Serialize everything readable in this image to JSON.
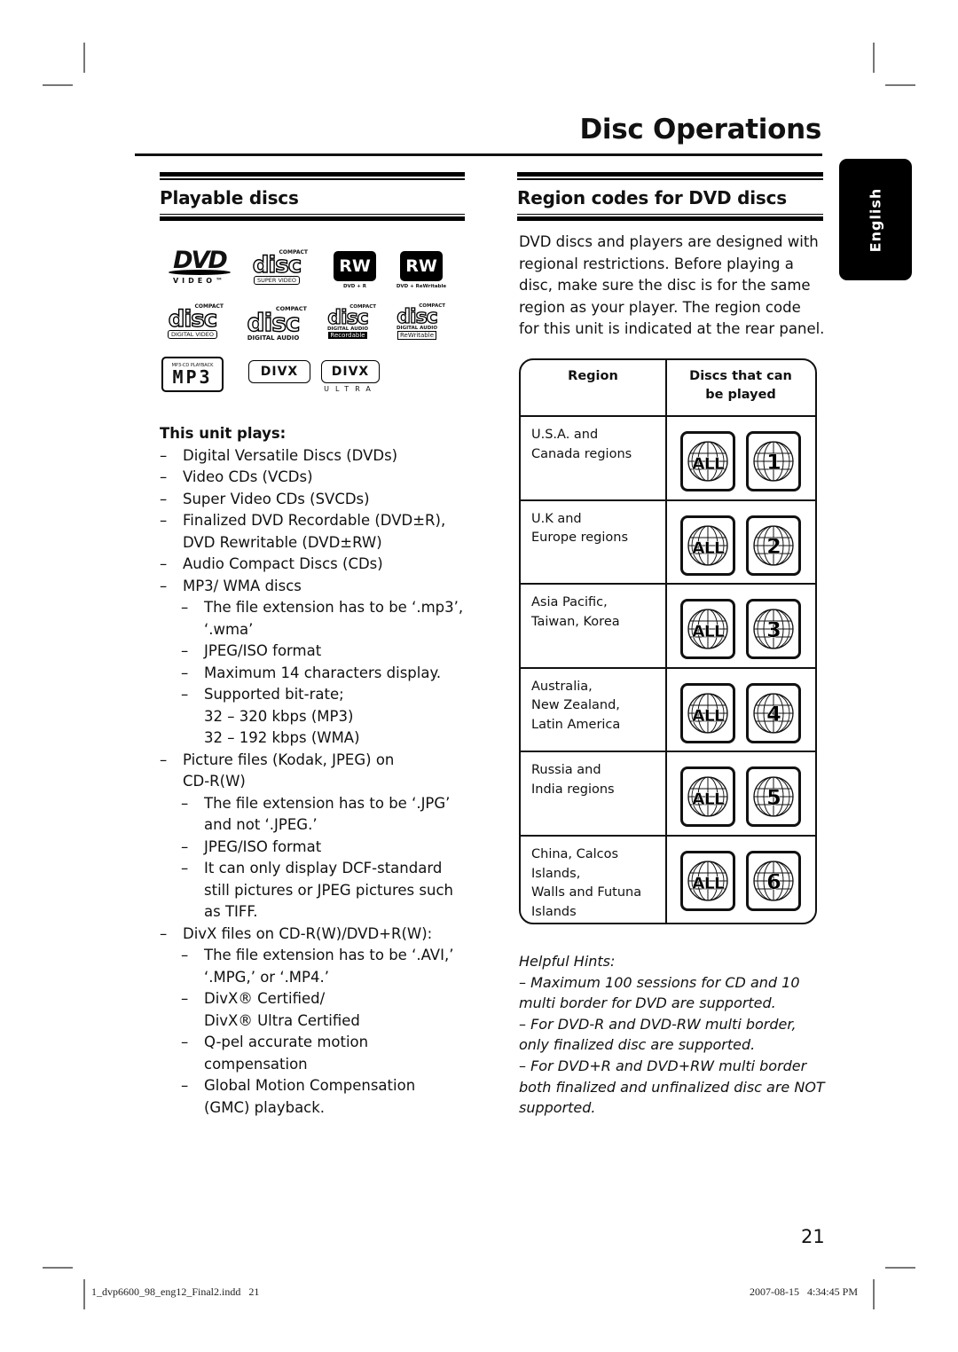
{
  "page": {
    "title": "Disc Operations",
    "page_number": "21",
    "language_tab": "English"
  },
  "playable": {
    "heading": "Playable discs",
    "logos": [
      {
        "name": "dvd-video-logo",
        "main": "DVD",
        "sub": "VIDEO™"
      },
      {
        "name": "compact-disc-super-video-logo",
        "top": "COMPACT",
        "main": "disc",
        "sub": "SUPER VIDEO"
      },
      {
        "name": "dvd-plus-r-logo",
        "main": "RW",
        "sub": "DVD + R"
      },
      {
        "name": "dvd-plus-rewritable-logo",
        "main": "RW",
        "sub": "DVD + ReWritable"
      },
      {
        "name": "compact-disc-digital-video-logo",
        "top": "COMPACT",
        "main": "disc",
        "sub": "DIGITAL VIDEO"
      },
      {
        "name": "compact-disc-digital-audio-logo",
        "top": "COMPACT",
        "main": "disc",
        "sub": "DIGITAL AUDIO"
      },
      {
        "name": "compact-disc-recordable-logo",
        "top": "COMPACT",
        "main": "disc",
        "sub": "DIGITAL AUDIO",
        "sub2": "Recordable"
      },
      {
        "name": "compact-disc-rewritable-logo",
        "top": "COMPACT",
        "main": "disc",
        "sub": "DIGITAL AUDIO",
        "sub2": "ReWritable"
      },
      {
        "name": "mp3-cd-playback-logo",
        "top": "MP3-CD PLAYBACK",
        "main": "MP3"
      },
      {
        "name": "divx-logo",
        "main": "DIVX"
      },
      {
        "name": "divx-ultra-logo",
        "main": "DIVX",
        "sub": "ULTRA"
      }
    ],
    "list_heading": "This unit plays:",
    "items": [
      {
        "level": 1,
        "lines": [
          "Digital Versatile Discs (DVDs)"
        ]
      },
      {
        "level": 1,
        "lines": [
          "Video CDs (VCDs)"
        ]
      },
      {
        "level": 1,
        "lines": [
          "Super Video CDs (SVCDs)"
        ]
      },
      {
        "level": 1,
        "lines": [
          "Finalized DVD Recordable (DVD±R),",
          "DVD Rewritable (DVD±RW)"
        ]
      },
      {
        "level": 1,
        "lines": [
          "Audio Compact Discs (CDs)"
        ]
      },
      {
        "level": 1,
        "lines": [
          "MP3/ WMA discs"
        ]
      },
      {
        "level": 2,
        "lines": [
          "The file extension has to be ‘.mp3’,",
          "‘.wma’"
        ]
      },
      {
        "level": 2,
        "lines": [
          "JPEG/ISO format"
        ]
      },
      {
        "level": 2,
        "lines": [
          "Maximum 14 characters display."
        ]
      },
      {
        "level": 2,
        "lines": [
          "Supported bit-rate;",
          "32 – 320 kbps (MP3)",
          "32 – 192 kbps (WMA)"
        ]
      },
      {
        "level": 1,
        "lines": [
          "Picture files (Kodak, JPEG) on",
          "CD-R(W)"
        ]
      },
      {
        "level": 2,
        "lines": [
          "The file extension has to be ‘.JPG’",
          "and not ‘.JPEG.’"
        ]
      },
      {
        "level": 2,
        "lines": [
          "JPEG/ISO format"
        ]
      },
      {
        "level": 2,
        "lines": [
          "It can only display DCF-standard",
          "still pictures or JPEG pictures such",
          "as TIFF."
        ]
      },
      {
        "level": 1,
        "lines": [
          "DivX files on CD-R(W)/DVD+R(W):"
        ]
      },
      {
        "level": 2,
        "lines": [
          "The file extension has to be ‘.AVI,’",
          "‘.MPG,’ or ‘.MP4.’"
        ]
      },
      {
        "level": 2,
        "lines": [
          "DivX® Certified/",
          "DivX® Ultra Certified"
        ]
      },
      {
        "level": 2,
        "lines": [
          "Q-pel accurate motion",
          "compensation"
        ]
      },
      {
        "level": 2,
        "lines": [
          "Global Motion Compensation",
          "(GMC) playback."
        ]
      }
    ],
    "dash": "–"
  },
  "region": {
    "heading": "Region codes for DVD discs",
    "intro": "DVD discs and players are designed with regional restrictions. Before playing a disc, make sure the disc is for the same region as your player. The region code for this unit is indicated at the rear panel.",
    "table": {
      "col_region": "Region",
      "col_discs": "Discs that can be played",
      "rows": [
        {
          "region": [
            "U.S.A. and",
            "Canada regions"
          ],
          "codes": [
            "ALL",
            "1"
          ]
        },
        {
          "region": [
            "U.K and",
            "Europe regions"
          ],
          "codes": [
            "ALL",
            "2"
          ]
        },
        {
          "region": [
            "Asia Pacific,",
            "Taiwan, Korea"
          ],
          "codes": [
            "ALL",
            "3"
          ]
        },
        {
          "region": [
            "Australia,",
            "New Zealand,",
            "Latin America"
          ],
          "codes": [
            "ALL",
            "4"
          ]
        },
        {
          "region": [
            "Russia and",
            "India regions"
          ],
          "codes": [
            "ALL",
            "5"
          ]
        },
        {
          "region": [
            "China, Calcos",
            "Islands,",
            "Walls and Futuna",
            "Islands"
          ],
          "codes": [
            "ALL",
            "6"
          ]
        }
      ]
    },
    "hints": {
      "title": "Helpful Hints:",
      "items": [
        "–  Maximum 100 sessions for CD and 10 multi border for DVD are supported.",
        "–  For DVD-R and DVD-RW multi border, only finalized disc are supported.",
        "–  For DVD+R and DVD+RW multi border both finalized and unfinalized disc are NOT supported."
      ]
    }
  },
  "slug": {
    "file": "1_dvp6600_98_eng12_Final2.indd   21",
    "timestamp": "2007-08-15   4:34:45 PM"
  }
}
